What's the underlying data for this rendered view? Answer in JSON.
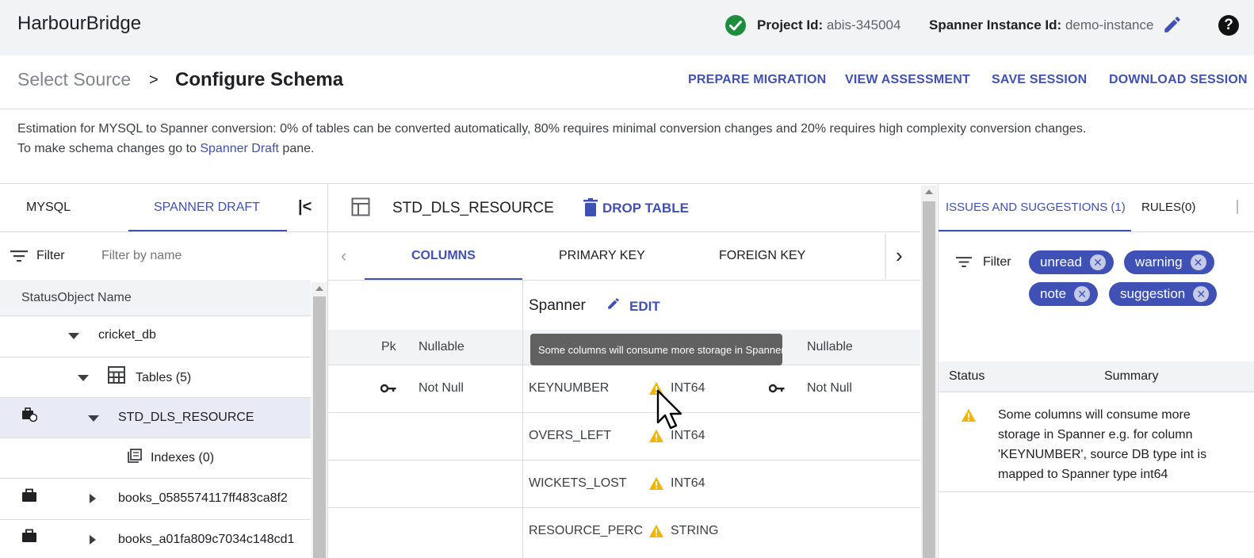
{
  "header": {
    "app_title": "HarbourBridge",
    "project_label": "Project Id:",
    "project_value": "abis-345004",
    "instance_label": "Spanner Instance Id:",
    "instance_value": "demo-instance",
    "help_glyph": "?"
  },
  "breadcrumb": {
    "step1": "Select Source",
    "separator": ">",
    "step2": "Configure Schema"
  },
  "actions": {
    "prepare": "PREPARE MIGRATION",
    "view": "VIEW ASSESSMENT",
    "save": "SAVE SESSION",
    "download": "DOWNLOAD SESSION"
  },
  "estimation": {
    "line1": "Estimation for MYSQL to Spanner conversion: 0% of tables can be converted automatically, 80% requires minimal conversion changes and 20% requires high complexity conversion changes.",
    "line2_prefix": "To make schema changes go to ",
    "line2_link": "Spanner Draft",
    "line2_suffix": " pane."
  },
  "left_panel": {
    "tab_mysql": "MYSQL",
    "tab_draft": "SPANNER DRAFT",
    "collapse_glyph": "|<",
    "filter_label": "Filter",
    "filter_placeholder": "Filter by name",
    "col_header": "StatusObject Name",
    "tree": {
      "db": "cricket_db",
      "tables": "Tables (5)",
      "selected_table": "STD_DLS_RESOURCE",
      "indexes": "Indexes (0)",
      "book1": "books_0585574117ff483ca8f2",
      "book2": "books_a01fa809c7034c148cd1"
    }
  },
  "middle_panel": {
    "table_name": "STD_DLS_RESOURCE",
    "drop_table": "DROP TABLE",
    "tabs": [
      "COLUMNS",
      "PRIMARY KEY",
      "FOREIGN KEY"
    ],
    "spanner_label": "Spanner",
    "edit_label": "EDIT",
    "col_pk": "Pk",
    "col_nullable": "Nullable",
    "col_nullable2": "Nullable",
    "tooltip": "Some columns will consume more storage in Spanner",
    "rows": [
      {
        "source_null": "Not Null",
        "name": "KEYNUMBER",
        "type": "INT64",
        "null": "Not Null"
      },
      {
        "name": "OVERS_LEFT",
        "type": "INT64"
      },
      {
        "name": "WICKETS_LOST",
        "type": "INT64"
      },
      {
        "name": "RESOURCE_PERC",
        "type": "STRING"
      }
    ]
  },
  "right_panel": {
    "tab_issues": "ISSUES AND SUGGESTIONS (1)",
    "tab_rules": "RULES(0)",
    "filter_label": "Filter",
    "chips": [
      "unread",
      "warning",
      "note",
      "suggestion"
    ],
    "col_status": "Status",
    "col_summary": "Summary",
    "issue_lines": [
      "Some columns will consume more",
      "storage in Spanner e.g. for column",
      "'KEYNUMBER', source DB type int is",
      "mapped to Spanner type int64"
    ]
  },
  "colors": {
    "accent": "#3f51b5",
    "success": "#1e8e3e",
    "warning": "#f4b400",
    "selected_row": "#e8eaf6"
  }
}
